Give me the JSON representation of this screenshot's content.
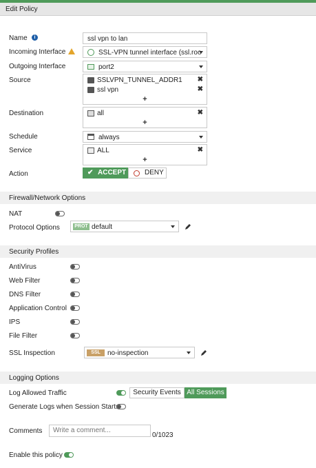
{
  "header": {
    "title": "Edit Policy"
  },
  "colors": {
    "accent": "#4f9a5a",
    "deny": "#c0392b",
    "prot_badge": "#8fbf8f",
    "ssl_badge": "#c9a066"
  },
  "form": {
    "name": {
      "label": "Name",
      "value": "ssl vpn to lan",
      "info_icon": "info-icon"
    },
    "incoming": {
      "label": "Incoming Interface",
      "warning_icon": "warning-icon",
      "value": "SSL-VPN tunnel interface (ssl.roo"
    },
    "outgoing": {
      "label": "Outgoing Interface",
      "value": "port2"
    },
    "source": {
      "label": "Source",
      "items": [
        "SSLVPN_TUNNEL_ADDR1",
        "ssl vpn"
      ],
      "add": "+"
    },
    "destination": {
      "label": "Destination",
      "items": [
        "all"
      ],
      "add": "+"
    },
    "schedule": {
      "label": "Schedule",
      "value": "always"
    },
    "service": {
      "label": "Service",
      "items": [
        "ALL"
      ],
      "add": "+"
    },
    "action": {
      "label": "Action",
      "accept": "ACCEPT",
      "deny": "DENY"
    }
  },
  "firewall": {
    "title": "Firewall/Network Options",
    "nat": {
      "label": "NAT",
      "enabled": false
    },
    "protocol": {
      "label": "Protocol Options",
      "badge": "PROT",
      "value": "default"
    }
  },
  "security": {
    "title": "Security Profiles",
    "profiles": [
      {
        "label": "AntiVirus",
        "enabled": false
      },
      {
        "label": "Web Filter",
        "enabled": false
      },
      {
        "label": "DNS Filter",
        "enabled": false
      },
      {
        "label": "Application Control",
        "enabled": false
      },
      {
        "label": "IPS",
        "enabled": false
      },
      {
        "label": "File Filter",
        "enabled": false
      }
    ],
    "ssl": {
      "label": "SSL Inspection",
      "badge": "SSL",
      "value": "no-inspection"
    }
  },
  "logging": {
    "title": "Logging Options",
    "log_allowed": {
      "label": "Log Allowed Traffic",
      "enabled": true,
      "option_events": "Security Events",
      "option_all": "All Sessions"
    },
    "generate": {
      "label": "Generate Logs when Session Starts",
      "enabled": false
    }
  },
  "comments": {
    "label": "Comments",
    "placeholder": "Write a comment...",
    "count": "0/1023"
  },
  "enable": {
    "label": "Enable this policy",
    "enabled": true
  }
}
